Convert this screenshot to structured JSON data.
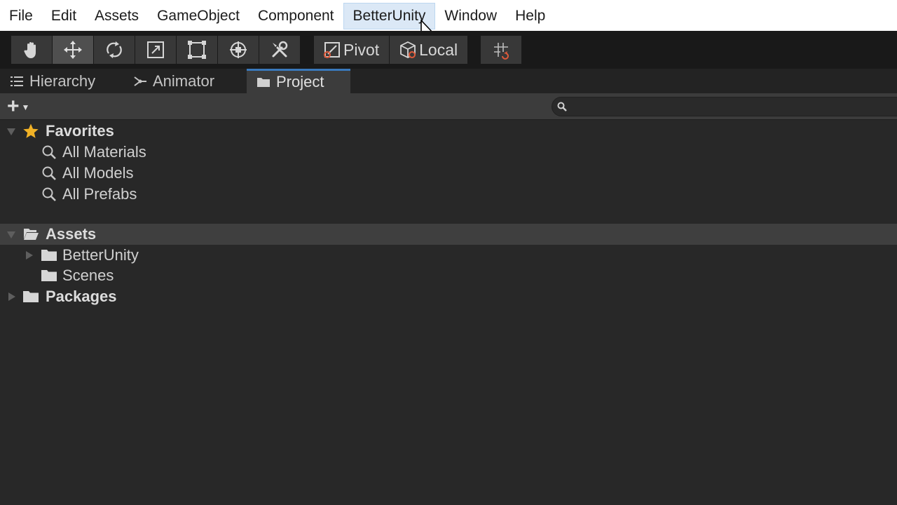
{
  "menubar": {
    "items": [
      "File",
      "Edit",
      "Assets",
      "GameObject",
      "Component",
      "BetterUnity",
      "Window",
      "Help"
    ]
  },
  "toolbar": {
    "tools": [
      "hand-tool",
      "move-tool",
      "rotate-tool",
      "scale-tool",
      "rect-tool",
      "transform-tool",
      "custom-tool"
    ],
    "active_tool": "move-tool",
    "pivot_label": "Pivot",
    "local_label": "Local"
  },
  "tabs": [
    {
      "label": "Hierarchy",
      "icon": "list-icon"
    },
    {
      "label": "Animator",
      "icon": "animator-icon"
    },
    {
      "label": "Project",
      "icon": "folder-icon",
      "active": true
    }
  ],
  "project": {
    "search_placeholder": "",
    "favorites": {
      "label": "Favorites",
      "items": [
        "All Materials",
        "All Models",
        "All Prefabs"
      ]
    },
    "assets": {
      "label": "Assets",
      "items": [
        "BetterUnity",
        "Scenes"
      ]
    },
    "packages": {
      "label": "Packages"
    }
  },
  "colors": {
    "menu_hover": "#dbe8f6",
    "tab_accent": "#3a79bb",
    "favorite_star": "#f1b226",
    "background": "#282828"
  }
}
